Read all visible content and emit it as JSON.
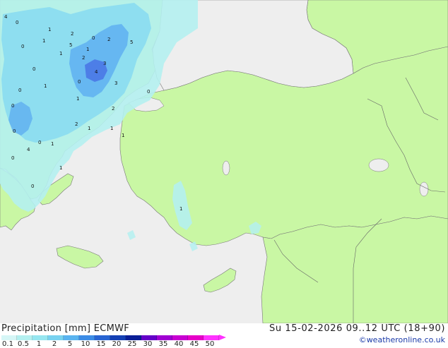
{
  "title_left": "Precipitation [mm] ECMWF",
  "title_right": "Su 15-02-2026 09..12 UTC (18+90)",
  "credit": "©weatheronline.co.uk",
  "colors": {
    "sea": "#eeeeee",
    "land": "#c9f7a4",
    "light_precip": "#b4f0f0",
    "mid_precip": "#8cdcf0",
    "heavy_precip": "#64b4f0",
    "very_heavy": "#4a78e6"
  },
  "legend": {
    "ticks": [
      "0.1",
      "0.5",
      "1",
      "2",
      "5",
      "10",
      "15",
      "20",
      "25",
      "30",
      "35",
      "40",
      "45",
      "50"
    ],
    "colors": [
      "#d6f6f6",
      "#b4f0f0",
      "#96e6f0",
      "#78d2f0",
      "#5ab4f0",
      "#3c8ce6",
      "#2864d2",
      "#1440b4",
      "#0a1e96",
      "#6400c8",
      "#a000d2",
      "#c800d2",
      "#e600c8",
      "#ff32ff"
    ]
  },
  "map_labels": [
    {
      "text": "4"
    },
    {
      "text": "0"
    },
    {
      "text": "1"
    },
    {
      "text": "2"
    },
    {
      "text": "0"
    },
    {
      "text": "1"
    },
    {
      "text": "5"
    },
    {
      "text": "2"
    },
    {
      "text": "1"
    },
    {
      "text": "0"
    },
    {
      "text": "1"
    },
    {
      "text": "0"
    },
    {
      "text": "2"
    },
    {
      "text": "3"
    },
    {
      "text": "4"
    },
    {
      "text": "0"
    },
    {
      "text": "1"
    },
    {
      "text": "3"
    },
    {
      "text": "1"
    },
    {
      "text": "0"
    },
    {
      "text": "2"
    },
    {
      "text": "1"
    },
    {
      "text": "0"
    },
    {
      "text": "1"
    },
    {
      "text": "0"
    },
    {
      "text": "1"
    },
    {
      "text": "4"
    },
    {
      "text": "0"
    },
    {
      "text": "0"
    },
    {
      "text": "1"
    },
    {
      "text": "1"
    },
    {
      "text": "2"
    },
    {
      "text": "0"
    },
    {
      "text": "5"
    },
    {
      "text": "0"
    },
    {
      "text": "1"
    }
  ]
}
